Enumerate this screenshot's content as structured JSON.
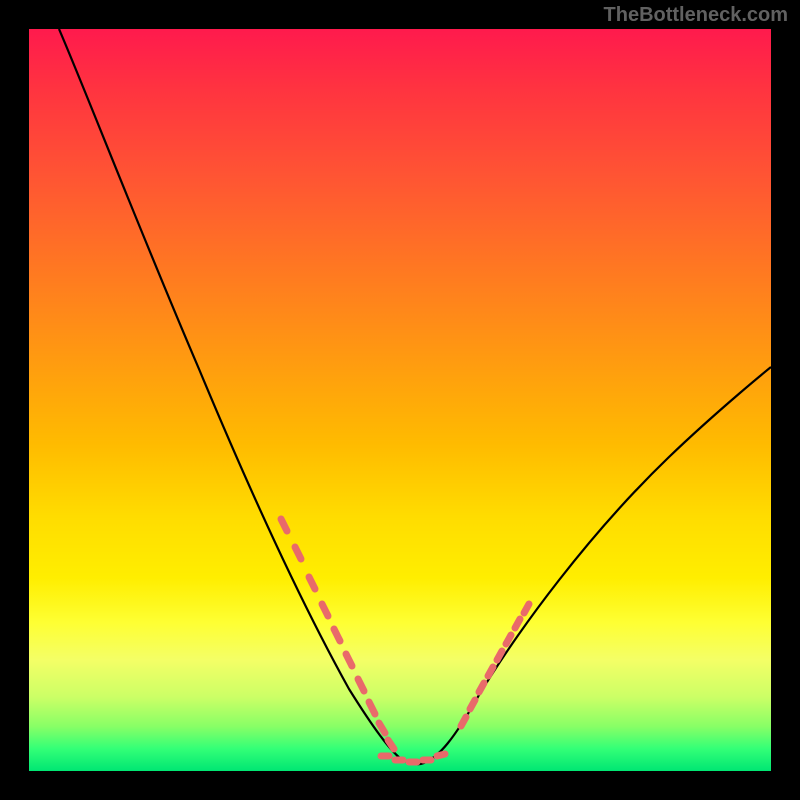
{
  "watermark": "TheBottleneck.com",
  "chart_data": {
    "type": "line",
    "title": "",
    "xlabel": "",
    "ylabel": "",
    "xlim": [
      0,
      100
    ],
    "ylim": [
      0,
      100
    ],
    "note": "V-shaped bottleneck curve plotted over a vertical rainbow gradient (red=high bottleneck at top, green=low at bottom). Left branch descends steeply from top-left; minimum near x≈50; right branch rises with decreasing slope toward the right edge. Axis ticks and numeric labels are not rendered in the image; values below are visual estimates in percent-of-plot units.",
    "series": [
      {
        "name": "bottleneck-curve",
        "x": [
          4,
          10,
          18,
          26,
          34,
          40,
          45,
          48,
          50,
          52,
          55,
          58,
          62,
          70,
          80,
          90,
          100
        ],
        "y": [
          100,
          87,
          70,
          53,
          35,
          22,
          11,
          4,
          1,
          1,
          3,
          6,
          11,
          21,
          33,
          43,
          52
        ]
      }
    ],
    "markers": {
      "name": "highlighted-points",
      "note": "Salmon-colored dash/dot markers clustered near the valley on both branches.",
      "x": [
        34,
        36,
        38,
        40,
        42,
        44,
        46,
        47,
        48,
        49,
        50,
        51,
        52,
        53,
        55,
        56,
        57,
        58,
        59,
        60,
        61,
        62
      ],
      "y": [
        35,
        31,
        26,
        22,
        17,
        13,
        9,
        6,
        4,
        2,
        1,
        1,
        1,
        2,
        3,
        4,
        5,
        6,
        8,
        9,
        10,
        11
      ]
    },
    "gradient_stops": [
      {
        "pos": 0,
        "color": "#ff1a4d"
      },
      {
        "pos": 50,
        "color": "#ffcc00"
      },
      {
        "pos": 80,
        "color": "#feff33"
      },
      {
        "pos": 100,
        "color": "#00e673"
      }
    ]
  }
}
